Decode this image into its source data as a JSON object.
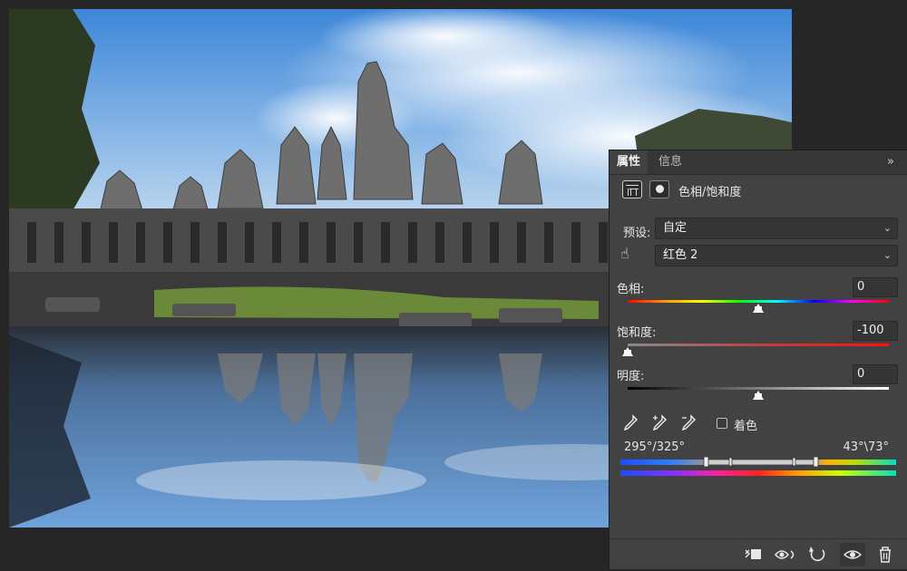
{
  "panel": {
    "tabs": [
      {
        "label": "属性",
        "active": true
      },
      {
        "label": "信息",
        "active": false
      }
    ],
    "collapse_glyph": "»",
    "adjustment_title": "色相/饱和度",
    "preset": {
      "label": "预设:",
      "value": "自定"
    },
    "channel": {
      "value": "红色 2"
    },
    "hue": {
      "label": "色相:",
      "value": "0",
      "level": 0.5
    },
    "saturation": {
      "label": "饱和度:",
      "value": "-100",
      "level": 0.0
    },
    "lightness": {
      "label": "明度:",
      "value": "0",
      "level": 0.5
    },
    "colorize": {
      "label": "着色",
      "checked": false
    },
    "range": {
      "left": "295°/325°",
      "right": "43°\\73°"
    },
    "icons": {
      "adjustment": "hue-saturation-layer-icon",
      "mask": "layer-mask-icon",
      "targeted_adjust": "hand-adjust-icon",
      "eyedroppers": [
        "eyedropper-icon",
        "eyedropper-plus-icon",
        "eyedropper-minus-icon"
      ],
      "bottom": [
        "clip-to-layer-icon",
        "view-previous-state-icon",
        "reset-icon",
        "visibility-icon",
        "delete-icon"
      ]
    }
  },
  "colors": {
    "panel_bg": "#424242",
    "tab_bar_bg": "#363636",
    "app_bg": "#262626"
  }
}
